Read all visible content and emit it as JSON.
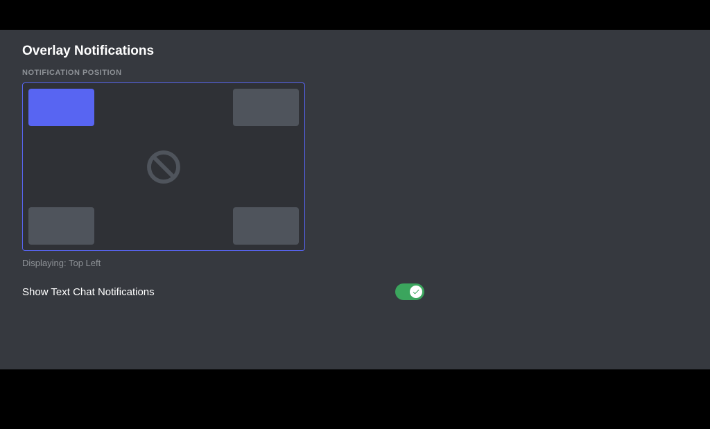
{
  "section": {
    "title": "Overlay Notifications"
  },
  "notificationPosition": {
    "label": "NOTIFICATION POSITION",
    "selected": "top-left",
    "displayingText": "Displaying: Top Left"
  },
  "textChatToggle": {
    "label": "Show Text Chat Notifications",
    "enabled": true
  },
  "colors": {
    "accent": "#5865f2",
    "toggleOn": "#3ba55d",
    "panelBg": "#36393f",
    "pickerBg": "#2f3136",
    "cornerInactive": "#4f545c"
  }
}
